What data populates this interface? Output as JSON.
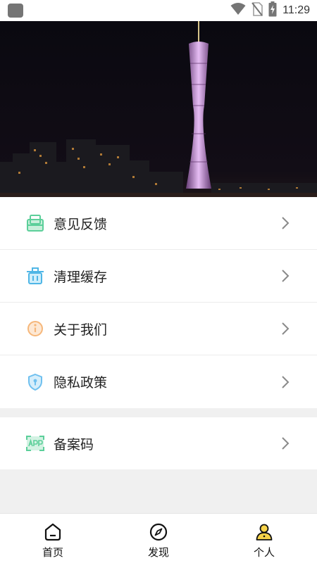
{
  "status_bar": {
    "time": "11:29",
    "icons": [
      "app-notification-icon",
      "wifi-icon",
      "no-sim-icon",
      "battery-charging-icon"
    ]
  },
  "hero": {
    "image": "canton-tower-night-skyline"
  },
  "menu": {
    "items": [
      {
        "label": "意见反馈",
        "icon": "feedback-icon",
        "color": "#5ccf9a"
      },
      {
        "label": "清理缓存",
        "icon": "clear-cache-icon",
        "color": "#4fb6e6"
      },
      {
        "label": "关于我们",
        "icon": "about-us-icon",
        "color": "#f6b77a"
      },
      {
        "label": "隐私政策",
        "icon": "privacy-shield-icon",
        "color": "#6fc0ef"
      }
    ],
    "secondary": [
      {
        "label": "备案码",
        "icon": "app-record-icon",
        "color": "#5ccf9a"
      }
    ]
  },
  "tab_bar": {
    "tabs": [
      {
        "label": "首页",
        "icon": "home-icon"
      },
      {
        "label": "发现",
        "icon": "compass-icon"
      },
      {
        "label": "个人",
        "icon": "profile-icon",
        "active": true,
        "accent": "#f6d34a"
      }
    ]
  }
}
